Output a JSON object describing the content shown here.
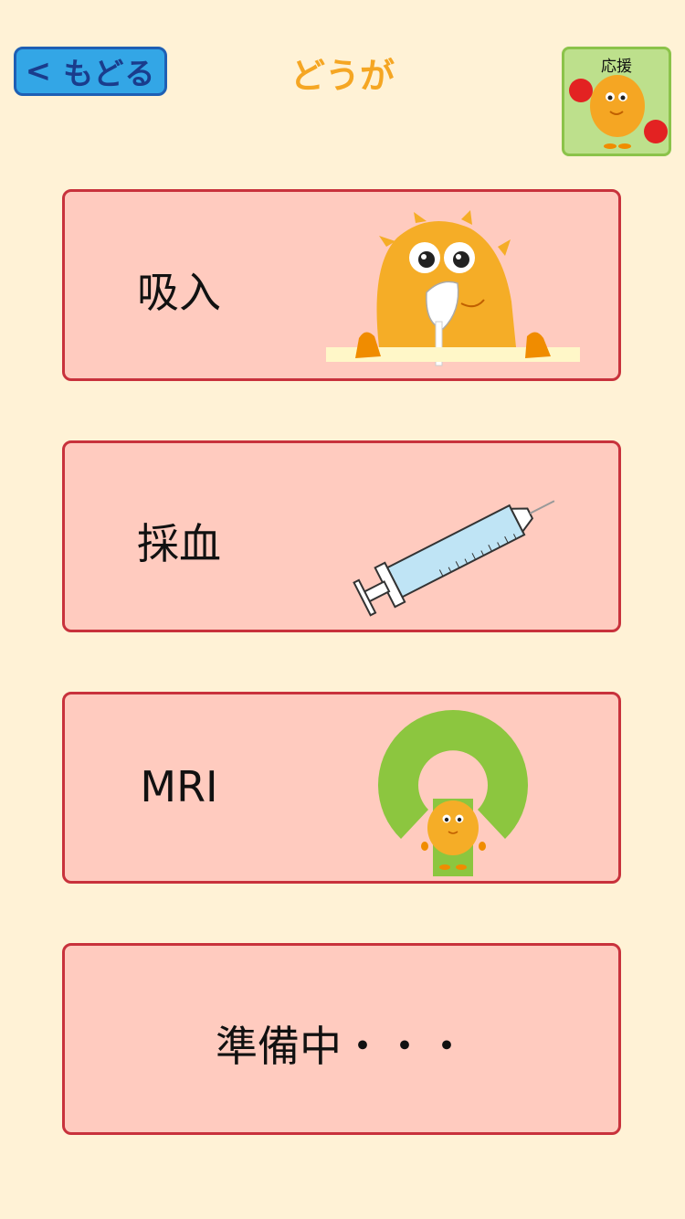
{
  "header": {
    "back_label": "もどる",
    "back_icon": "chevron-left-icon",
    "title": "どうが",
    "cheer_label": "応援"
  },
  "menu": {
    "items": [
      {
        "label": "吸入",
        "illustration": "inhaler-character-icon"
      },
      {
        "label": "採血",
        "illustration": "syringe-icon"
      },
      {
        "label": "MRI",
        "illustration": "mri-character-icon"
      },
      {
        "label": "準備中・・・"
      }
    ]
  },
  "colors": {
    "background": "#fff2d6",
    "card_fill": "#ffcbbf",
    "card_border": "#c8323c",
    "title": "#f5a623",
    "back_button": "#33a6e6",
    "cheer_fill": "#bde08c"
  }
}
